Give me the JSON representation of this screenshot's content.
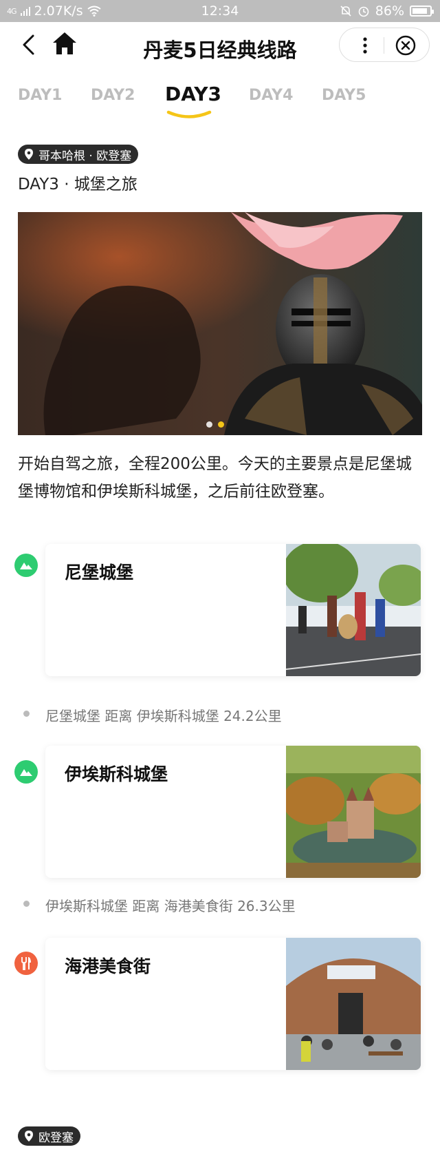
{
  "status_bar": {
    "signal": "4G",
    "speed": "2.07K/s",
    "time": "12:34",
    "battery": "86%",
    "battery_level": 0.86
  },
  "nav": {
    "title": "丹麦5日经典线路",
    "back_icon": "chevron-left-icon",
    "home_icon": "home-icon",
    "more_icon": "more-vertical-icon",
    "close_icon": "close-circle-icon"
  },
  "tabs": [
    {
      "label": "DAY1",
      "active": false
    },
    {
      "label": "DAY2",
      "active": false
    },
    {
      "label": "DAY3",
      "active": true
    },
    {
      "label": "DAY4",
      "active": false
    },
    {
      "label": "DAY5",
      "active": false
    }
  ],
  "accent_color": "#f5c518",
  "day": {
    "location": "哥本哈根 · 欧登塞",
    "title": "DAY3 · 城堡之旅",
    "description": "开始自驾之旅，全程200公里。今天的主要景点是尼堡城堡博物馆和伊埃斯科城堡，之后前往欧登塞。",
    "carousel_index": 2,
    "carousel_count": 2
  },
  "spots": [
    {
      "name": "尼堡城堡",
      "icon": "mountain-icon",
      "icon_color": "#2ecc71"
    },
    {
      "name": "伊埃斯科城堡",
      "icon": "mountain-icon",
      "icon_color": "#2ecc71"
    },
    {
      "name": "海港美食街",
      "icon": "fork-knife-icon",
      "icon_color": "#f0623f"
    }
  ],
  "distances": [
    "尼堡城堡 距离 伊埃斯科城堡 24.2公里",
    "伊埃斯科城堡 距离 海港美食街 26.3公里"
  ],
  "next_location": "欧登塞"
}
